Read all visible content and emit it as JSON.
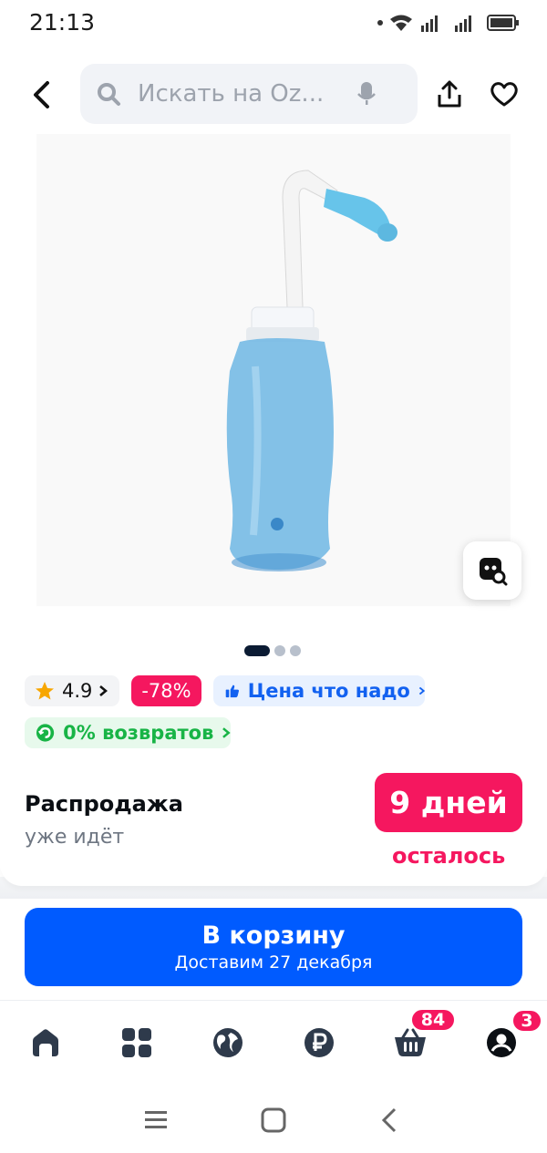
{
  "status": {
    "time": "21:13"
  },
  "search": {
    "placeholder": "Искать на Oz..."
  },
  "badges": {
    "rating": "4.9",
    "discount": "-78%",
    "price_ok": "Цена что надо",
    "returns": "0% возвратов"
  },
  "sale": {
    "title": "Распродажа",
    "subtitle": "уже идёт",
    "days": "9 дней",
    "left": "осталось"
  },
  "cart_button": {
    "label": "В корзину",
    "delivery": "Доставим 27 декабря"
  },
  "tabbar": {
    "cart_count": "84",
    "profile_count": "3"
  },
  "colors": {
    "brand": "#005bff",
    "sale": "#f5175f",
    "success": "#18b446"
  },
  "icons": [
    "back-arrow-icon",
    "search-icon",
    "mic-icon",
    "share-icon",
    "heart-icon",
    "similar-search-icon",
    "star-icon",
    "thumb-up-icon",
    "return-icon",
    "home-icon",
    "catalog-icon",
    "fresh-icon",
    "ruble-icon",
    "cart-icon",
    "profile-icon"
  ]
}
